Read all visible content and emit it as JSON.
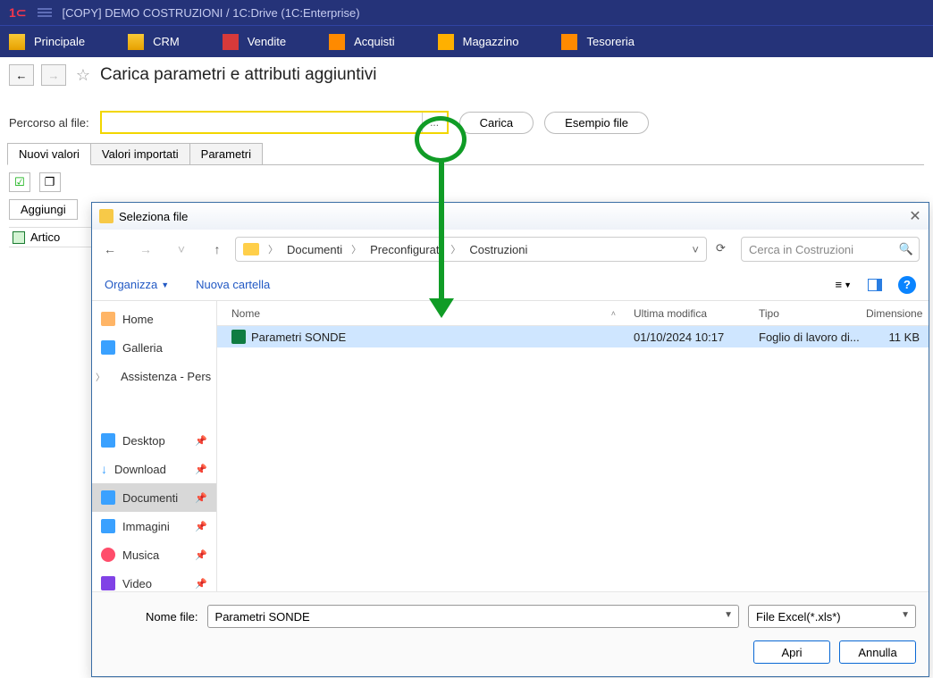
{
  "app": {
    "title": "[COPY] DEMO COSTRUZIONI / 1C:Drive  (1C:Enterprise)"
  },
  "mainnav": [
    {
      "label": "Principale",
      "icon": "ic-home"
    },
    {
      "label": "CRM",
      "icon": "ic-crm"
    },
    {
      "label": "Vendite",
      "icon": "ic-vendite"
    },
    {
      "label": "Acquisti",
      "icon": "ic-acquisti"
    },
    {
      "label": "Magazzino",
      "icon": "ic-magazzino"
    },
    {
      "label": "Tesoreria",
      "icon": "ic-tesoreria"
    }
  ],
  "page": {
    "title": "Carica parametri e attributi aggiuntivi",
    "path_label": "Percorso al file:",
    "browse_btn": "...",
    "load_btn": "Carica",
    "example_btn": "Esempio file",
    "tabs": [
      "Nuovi valori",
      "Valori importati",
      "Parametri"
    ],
    "add_btn": "Aggiungi",
    "list_item": "Artico"
  },
  "dialog": {
    "title": "Seleziona file",
    "breadcrumb": [
      "Documenti",
      "Preconfigurati",
      "Costruzioni"
    ],
    "search_placeholder": "Cerca in Costruzioni",
    "organize": "Organizza",
    "newfolder": "Nuova cartella",
    "sidebar": [
      {
        "label": "Home",
        "icon": "si-home"
      },
      {
        "label": "Galleria",
        "icon": "si-gal"
      },
      {
        "label": "Assistenza - Pers",
        "icon": "si-cloud",
        "chev": true
      },
      {
        "label": "Desktop",
        "icon": "si-desk",
        "pin": true
      },
      {
        "label": "Download",
        "icon": "si-down",
        "pin": true,
        "downarrow": true
      },
      {
        "label": "Documenti",
        "icon": "si-doc",
        "pin": true,
        "active": true
      },
      {
        "label": "Immagini",
        "icon": "si-img",
        "pin": true
      },
      {
        "label": "Musica",
        "icon": "si-mus",
        "pin": true
      },
      {
        "label": "Video",
        "icon": "si-vid",
        "pin": true
      }
    ],
    "cols": {
      "name": "Nome",
      "modified": "Ultima modifica",
      "type": "Tipo",
      "size": "Dimensione"
    },
    "rows": [
      {
        "name": "Parametri SONDE",
        "modified": "01/10/2024 10:17",
        "type": "Foglio di lavoro di...",
        "size": "11 KB",
        "selected": true
      }
    ],
    "filename_label": "Nome file:",
    "filename_value": "Parametri SONDE",
    "filter": "File Excel(*.xls*)",
    "open_btn": "Apri",
    "cancel_btn": "Annulla"
  }
}
